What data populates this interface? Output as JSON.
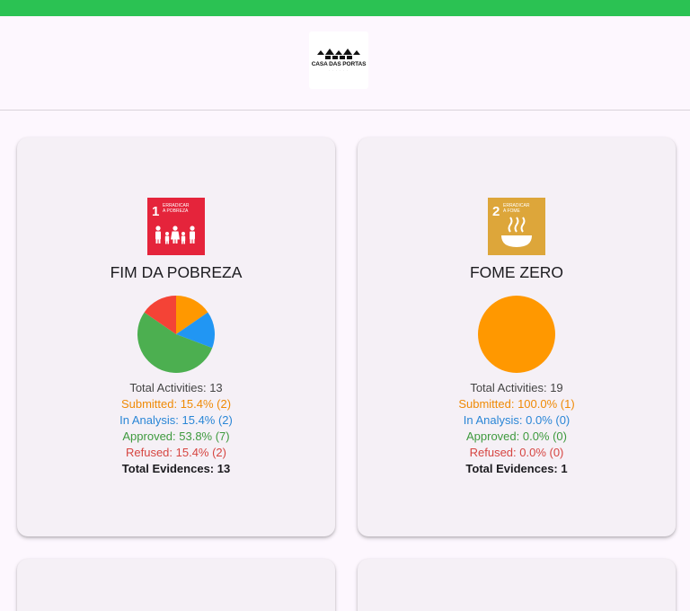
{
  "header": {
    "logo_text": "CASA DAS PORTAS",
    "status_bar_color": "#2bc253"
  },
  "cards": [
    {
      "icon": {
        "number": "1",
        "label_line1": "ERRADICAR",
        "label_line2": "A POBREZA",
        "color": "#e5243b",
        "symbol": "family-icon"
      },
      "title": "FIM DA POBREZA",
      "total_activities": "Total Activities: 13",
      "submitted": "Submitted: 15.4% (2)",
      "in_analysis": "In Analysis: 15.4% (2)",
      "approved": "Approved: 53.8% (7)",
      "refused": "Refused: 15.4% (2)",
      "total_evidences": "Total Evidences: 13",
      "pie": {
        "submitted": 2,
        "in_analysis": 2,
        "approved": 7,
        "refused": 2
      }
    },
    {
      "icon": {
        "number": "2",
        "label_line1": "ERRADICAR",
        "label_line2": "A FOME",
        "color": "#dda63a",
        "symbol": "bowl-icon"
      },
      "title": "FOME ZERO",
      "total_activities": "Total Activities: 19",
      "submitted": "Submitted: 100.0% (1)",
      "in_analysis": "In Analysis: 0.0% (0)",
      "approved": "Approved: 0.0% (0)",
      "refused": "Refused: 0.0% (0)",
      "total_evidences": "Total Evidences: 1",
      "pie": {
        "submitted": 1,
        "in_analysis": 0,
        "approved": 0,
        "refused": 0
      }
    }
  ],
  "status_colors": {
    "submitted": "#ff9800",
    "in_analysis": "#2196f3",
    "approved": "#4caf50",
    "refused": "#f44336"
  }
}
